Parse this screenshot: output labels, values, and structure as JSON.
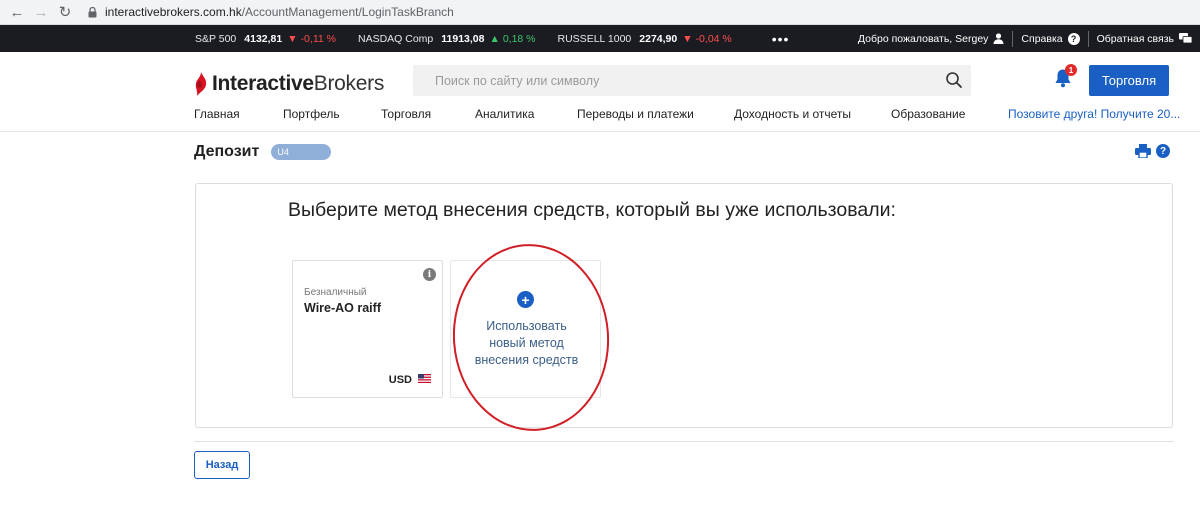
{
  "browser": {
    "url_domain": "interactivebrokers.com.hk",
    "url_path": "/AccountManagement/LoginTaskBranch"
  },
  "ticker": {
    "items": [
      {
        "name": "S&P 500",
        "value": "4132,81",
        "change": "-0,11 %",
        "direction": "down"
      },
      {
        "name": "NASDAQ Comp",
        "value": "11913,08",
        "change": "0,18 %",
        "direction": "up"
      },
      {
        "name": "RUSSELL 1000",
        "value": "2274,90",
        "change": "-0,04 %",
        "direction": "down"
      }
    ],
    "more": "•••",
    "welcome": "Добро пожаловать, Sergey",
    "help": "Справка",
    "feedback": "Обратная связь"
  },
  "header": {
    "logo_bold": "Interactive",
    "logo_regular": "Brokers",
    "search_placeholder": "Поиск по сайту или символу",
    "notifications_count": "1",
    "trade_button": "Торговля"
  },
  "menu": {
    "items": [
      "Главная",
      "Портфель",
      "Торговля",
      "Аналитика",
      "Переводы и платежи",
      "Доходность и отчеты",
      "Образование"
    ],
    "promo": "Позовите друга! Получите 20..."
  },
  "page": {
    "title": "Депозит",
    "account_pill": "U4"
  },
  "panel": {
    "heading": "Выберите метод внесения средств, который вы уже использовали:",
    "method_card": {
      "type": "Безналичный",
      "name": "Wire-AO raiff",
      "currency": "USD"
    },
    "new_method": {
      "line1": "Использовать",
      "line2": "новый метод",
      "line3": "внесения средств"
    }
  },
  "footer": {
    "back_button": "Назад"
  },
  "colors": {
    "accent": "#1a5fc3",
    "ticker_bg": "#1b1c21",
    "down": "#ff4d4d",
    "up": "#3ec46d",
    "annotation": "#d01f26"
  }
}
